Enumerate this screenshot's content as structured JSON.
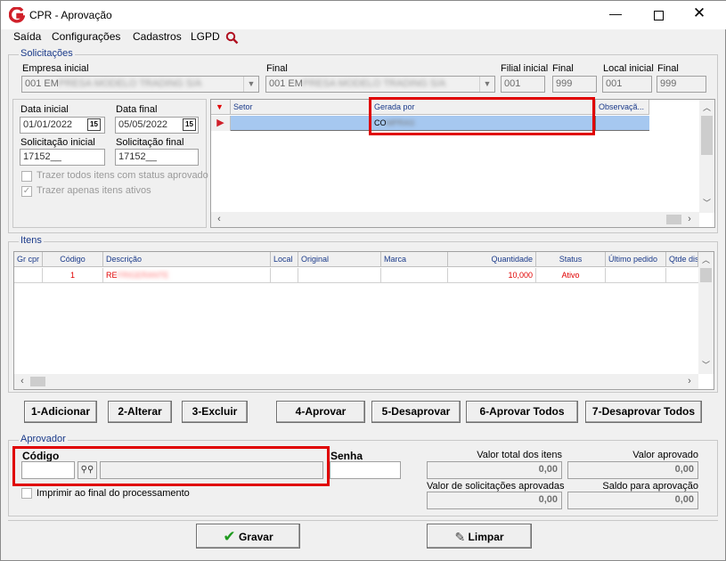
{
  "window": {
    "title": "CPR - Aprovação",
    "icon": "app-logo-icon"
  },
  "menu": {
    "items": [
      "Saída",
      "Configurações",
      "Cadastros",
      "LGPD"
    ],
    "search_icon": "search-icon"
  },
  "solicitacoes": {
    "group_label": "Solicitações",
    "empresa_inicial_label": "Empresa inicial",
    "empresa_inicial_value": "001 EM",
    "empresa_inicial_hidden": "PRESA MODELO TRADING S/A",
    "empresa_final_label": "Final",
    "empresa_final_value": "001 EM",
    "empresa_final_hidden": "PRESA MODELO TRADING S/A",
    "filial_inicial_label": "Filial inicial",
    "filial_inicial_value": "001",
    "filial_final_label": "Final",
    "filial_final_value": "999",
    "local_inicial_label": "Local inicial",
    "local_inicial_value": "001",
    "local_final_label": "Final",
    "local_final_value": "999",
    "data_inicial_label": "Data inicial",
    "data_inicial_value": "01/01/2022",
    "data_final_label": "Data final",
    "data_final_value": "05/05/2022",
    "cal_label": "15",
    "sol_inicial_label": "Solicitação inicial",
    "sol_inicial_value": "17152__",
    "sol_final_label": "Solicitação final",
    "sol_final_value": "17152__",
    "chk1_label": "Trazer todos itens com status aprovado",
    "chk2_label": "Trazer apenas itens ativos",
    "chk2_mark": "✓"
  },
  "sol_grid": {
    "headers": [
      "Setor",
      "Gerada por",
      "Observaçã..."
    ],
    "row": {
      "setor": "",
      "gerada_por": "CO",
      "gerada_hidden": "MPRAS",
      "obs": ""
    }
  },
  "itens": {
    "group_label": "Itens",
    "headers": [
      "Gr cpr",
      "Código",
      "Descrição",
      "Local",
      "Original",
      "Marca",
      "Quantidade",
      "Status",
      "Último pedido",
      "Qtde dis"
    ],
    "rows": [
      {
        "codigo": "1",
        "descricao": "RE",
        "descricao_hidden": "FRIGERANTE",
        "quantidade": "10,000",
        "status": "Ativo"
      }
    ],
    "row_color": "#e00000"
  },
  "actions": {
    "adicionar": "1-Adicionar",
    "alterar": "2-Alterar",
    "excluir": "3-Excluir",
    "aprovar": "4-Aprovar",
    "desaprovar": "5-Desaprovar",
    "aprovar_todos": "6-Aprovar Todos",
    "desaprovar_todos": "7-Desaprovar Todos"
  },
  "aprovador": {
    "group_label": "Aprovador",
    "codigo_label": "Código",
    "senha_label": "Senha",
    "imprimir_label": "Imprimir ao final do processamento",
    "valor_total_label": "Valor total dos itens",
    "valor_total_value": "0,00",
    "valor_aprovado_label": "Valor aprovado",
    "valor_aprovado_value": "0,00",
    "valor_sol_aprov_label": "Valor de solicitações aprovadas",
    "valor_sol_aprov_value": "0,00",
    "saldo_label": "Saldo para aprovação",
    "saldo_value": "0,00"
  },
  "footer": {
    "gravar": "Gravar",
    "limpar": "Limpar"
  },
  "colors": {
    "highlight_red": "#e00000",
    "selected_row": "#a6c8f0",
    "brand_red": "#d0202a"
  }
}
